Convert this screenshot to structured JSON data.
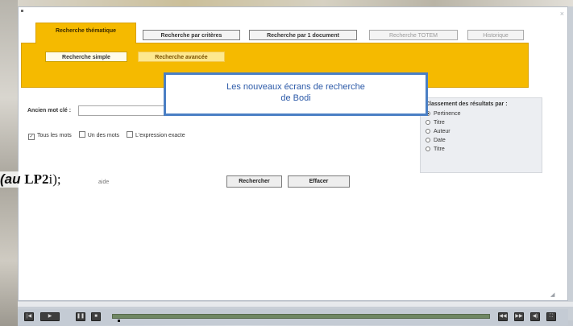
{
  "window": {
    "close_label": "×"
  },
  "tabs": [
    {
      "label": "Recherche thématique"
    },
    {
      "label": "Recherche par critères"
    },
    {
      "label": "Recherche par 1 document"
    },
    {
      "label": "Recherche TOTEM"
    },
    {
      "label": "Historique"
    }
  ],
  "subtabs": [
    {
      "label": "Recherche simple"
    },
    {
      "label": "Recherche avancée"
    }
  ],
  "callout": {
    "line1": "Les nouveaux écrans de recherche",
    "line2": "de Bodi"
  },
  "search": {
    "label": "Ancien mot clé :",
    "value": "",
    "placeholder": ""
  },
  "options": [
    {
      "label": "Tous les mots",
      "checked": true
    },
    {
      "label": "Un des mots",
      "checked": false
    },
    {
      "label": "L'expression exacte",
      "checked": false
    }
  ],
  "sort": {
    "title": "Classement des résultats par :",
    "options": [
      {
        "label": "Pertinence",
        "selected": true
      },
      {
        "label": "Titre",
        "selected": false
      },
      {
        "label": "Auteur",
        "selected": false
      },
      {
        "label": "Date",
        "selected": false
      },
      {
        "label": "Titre",
        "selected": false
      }
    ]
  },
  "buttons": {
    "search": "Rechercher",
    "clear": "Effacer"
  },
  "caption": {
    "part1": "(au ",
    "part2": "LP2",
    "part3": "i);"
  },
  "ghost_text": "aide",
  "player": {
    "rewind": "|◀",
    "play": "▶",
    "pause": "❚❚",
    "stop": "■",
    "progress": 0.01,
    "right_buttons": [
      "◀◀",
      "▶▶",
      "◀)",
      "⛶"
    ]
  },
  "colors": {
    "tab_accent": "#f5ba00",
    "callout_border": "#4a7fc4",
    "progress_track": "#6f8763"
  },
  "icons": [
    "close-icon",
    "rewind-icon",
    "play-icon",
    "pause-icon",
    "stop-icon",
    "back-icon",
    "forward-icon",
    "volume-icon",
    "fullscreen-icon"
  ]
}
